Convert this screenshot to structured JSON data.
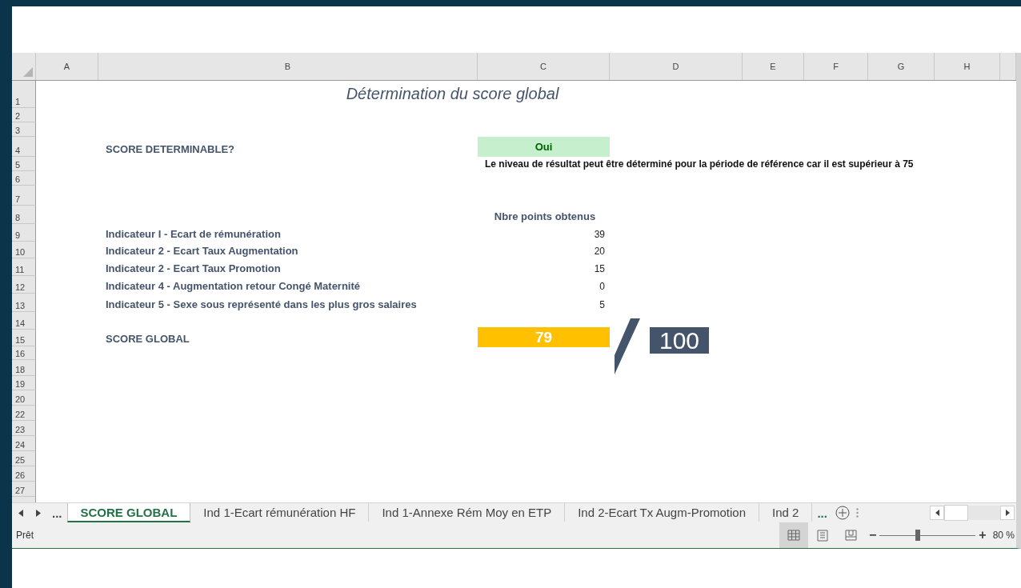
{
  "columns": [
    "A",
    "B",
    "C",
    "D",
    "E",
    "F",
    "G",
    "H"
  ],
  "rows": [
    "1",
    "2",
    "3",
    "4",
    "5",
    "6",
    "7",
    "8",
    "9",
    "10",
    "11",
    "12",
    "13",
    "14",
    "15",
    "16",
    "18",
    "19",
    "20",
    "22",
    "23",
    "24",
    "25",
    "26",
    "27"
  ],
  "title": "Détermination du score global",
  "determinable": {
    "label": "SCORE DETERMINABLE?",
    "value": "Oui",
    "note": "Le niveau de résultat peut être déterminé pour la période de référence car il est supérieur à **75**"
  },
  "points_header": "Nbre points obtenus",
  "indicators": [
    {
      "label": "Indicateur I - Ecart de rémunération",
      "points": "39"
    },
    {
      "label": "Indicateur 2 - Ecart Taux Augmentation",
      "points": "20"
    },
    {
      "label": "Indicateur 2 - Ecart Taux Promotion",
      "points": "15"
    },
    {
      "label": "Indicateur 4 - Augmentation retour Congé Maternité",
      "points": "0"
    },
    {
      "label": "Indicateur 5 - Sexe sous représenté dans les plus gros salaires",
      "points": "5"
    }
  ],
  "score_global": {
    "label": "SCORE GLOBAL",
    "value": "79",
    "max": "100"
  },
  "sheet_nav": {
    "more": "..."
  },
  "sheet_tabs": [
    {
      "label": "SCORE GLOBAL",
      "selected": true
    },
    {
      "label": "Ind 1-Ecart rémunération HF",
      "selected": false
    },
    {
      "label": "Ind 1-Annexe Rém Moy en ETP",
      "selected": false
    },
    {
      "label": "Ind 2-Ecart Tx Augm-Promotion",
      "selected": false
    },
    {
      "label": "Ind 2",
      "selected": false
    }
  ],
  "tabs_more": "...",
  "status_bar": {
    "status": "Prêt",
    "view_buttons": [
      {
        "kind": "normal",
        "selected": true
      },
      {
        "kind": "page_layout",
        "selected": false
      },
      {
        "kind": "page_break",
        "selected": false
      }
    ],
    "zoom_minus": "−",
    "zoom_plus": "+",
    "zoom": {
      "level": 0.4
    },
    "zoom_label": "80 %"
  }
}
